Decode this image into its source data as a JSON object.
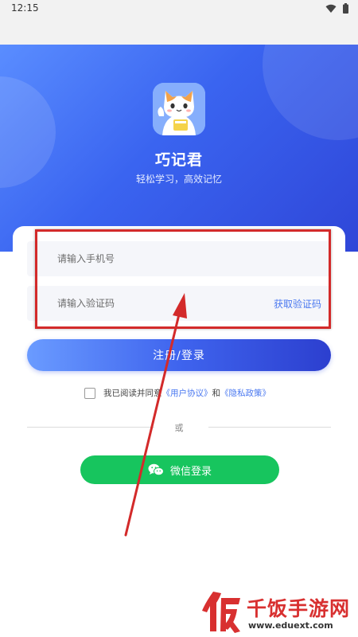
{
  "status_bar": {
    "time": "12:15",
    "icons": [
      "wifi-icon",
      "battery-icon"
    ]
  },
  "hero": {
    "app_name": "巧记君",
    "slogan": "轻松学习，高效记忆"
  },
  "form": {
    "phone_placeholder": "请输入手机号",
    "code_placeholder": "请输入验证码",
    "get_code_label": "获取验证码",
    "login_label": "注册/登录",
    "agree_prefix": "我已阅读并同意",
    "user_agreement": "《用户协议》",
    "agree_and": "和",
    "privacy_policy": "《隐私政策》",
    "or_label": "或",
    "wechat_label": "微信登录"
  },
  "watermark": {
    "brand": "千饭手游网",
    "url": "www.eduext.com"
  },
  "colors": {
    "hero_gradient": [
      "#5a8dff",
      "#2f46d8"
    ],
    "accent_link": "#4a78f0",
    "wechat_green": "#17c55e",
    "annotation_red": "#d32a2a"
  }
}
